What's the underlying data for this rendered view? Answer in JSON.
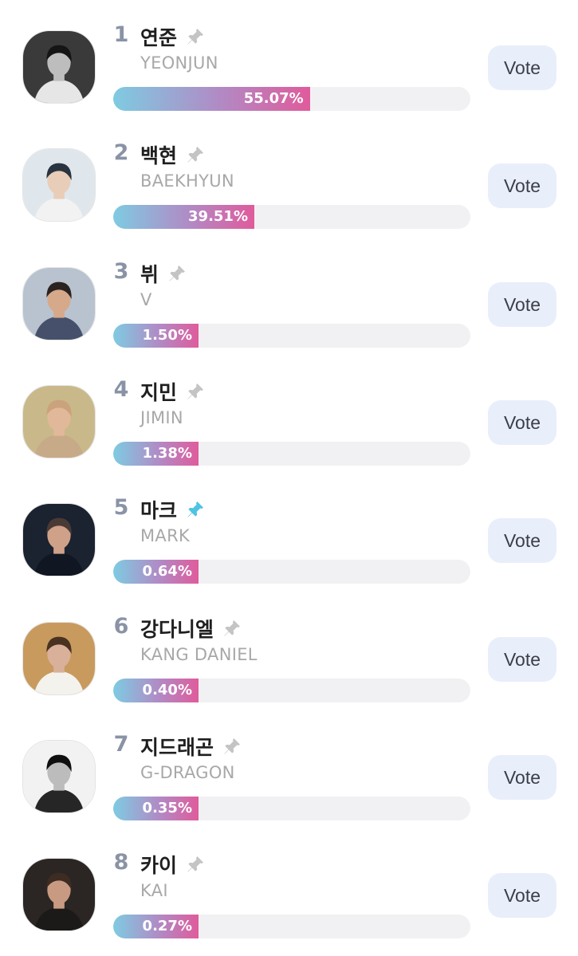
{
  "vote_button_label": "Vote",
  "colors": {
    "rank": "#8a93a6",
    "pin_inactive": "#c4c4c4",
    "pin_active": "#4fc3e4",
    "bar_start": "#7ecbe2",
    "bar_end": "#e05b9c",
    "track": "#f1f1f3",
    "vote_bg": "#e9eefb"
  },
  "ranking": [
    {
      "rank": "1",
      "name_ko": "연준",
      "name_en": "YEONJUN",
      "percent_label": "55.07%",
      "share": 55.07,
      "pinned": false,
      "avatar_icon": "avatar-photo"
    },
    {
      "rank": "2",
      "name_ko": "백현",
      "name_en": "BAEKHYUN",
      "percent_label": "39.51%",
      "share": 39.51,
      "pinned": false,
      "avatar_icon": "avatar-photo"
    },
    {
      "rank": "3",
      "name_ko": "뷔",
      "name_en": "V",
      "percent_label": "1.50%",
      "share": 1.5,
      "pinned": false,
      "avatar_icon": "avatar-photo"
    },
    {
      "rank": "4",
      "name_ko": "지민",
      "name_en": "JIMIN",
      "percent_label": "1.38%",
      "share": 1.38,
      "pinned": false,
      "avatar_icon": "avatar-photo"
    },
    {
      "rank": "5",
      "name_ko": "마크",
      "name_en": "MARK",
      "percent_label": "0.64%",
      "share": 0.64,
      "pinned": true,
      "avatar_icon": "avatar-photo"
    },
    {
      "rank": "6",
      "name_ko": "강다니엘",
      "name_en": "KANG DANIEL",
      "percent_label": "0.40%",
      "share": 0.4,
      "pinned": false,
      "avatar_icon": "avatar-photo"
    },
    {
      "rank": "7",
      "name_ko": "지드래곤",
      "name_en": "G-DRAGON",
      "percent_label": "0.35%",
      "share": 0.35,
      "pinned": false,
      "avatar_icon": "avatar-photo"
    },
    {
      "rank": "8",
      "name_ko": "카이",
      "name_en": "KAI",
      "percent_label": "0.27%",
      "share": 0.27,
      "pinned": false,
      "avatar_icon": "avatar-photo"
    }
  ]
}
